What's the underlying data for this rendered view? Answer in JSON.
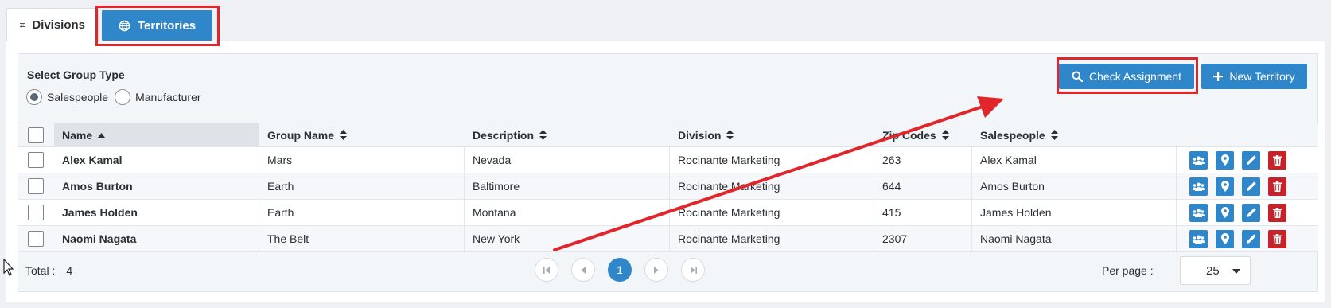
{
  "tabs": [
    {
      "label": "Divisions",
      "icon": "sliders-icon",
      "active": false
    },
    {
      "label": "Territories",
      "icon": "globe-icon",
      "active": true
    }
  ],
  "group_type": {
    "label": "Select Group Type",
    "options": [
      {
        "label": "Salespeople",
        "selected": true
      },
      {
        "label": "Manufacturer",
        "selected": false
      }
    ]
  },
  "toolbar": {
    "check_label": "Check Assignment",
    "new_label": "New Territory"
  },
  "table": {
    "columns": [
      "Name",
      "Group Name",
      "Description",
      "Division",
      "Zip Codes",
      "Salespeople"
    ],
    "rows": [
      {
        "name": "Alex Kamal",
        "group": "Mars",
        "description": "Nevada",
        "division": "Rocinante Marketing",
        "zip": "263",
        "salespeople": "Alex Kamal"
      },
      {
        "name": "Amos Burton",
        "group": "Earth",
        "description": "Baltimore",
        "division": "Rocinante Marketing",
        "zip": "644",
        "salespeople": "Amos Burton"
      },
      {
        "name": "James Holden",
        "group": "Earth",
        "description": "Montana",
        "division": "Rocinante Marketing",
        "zip": "415",
        "salespeople": "James Holden"
      },
      {
        "name": "Naomi Nagata",
        "group": "The Belt",
        "description": "New York",
        "division": "Rocinante Marketing",
        "zip": "2307",
        "salespeople": "Naomi Nagata"
      }
    ]
  },
  "footer": {
    "total_label": "Total :",
    "total_value": "4",
    "current_page": "1",
    "per_page_label": "Per page :",
    "per_page_value": "25"
  },
  "colors": {
    "primary": "#2f86c8",
    "danger": "#c6222a",
    "annotation": "#e0262b"
  }
}
